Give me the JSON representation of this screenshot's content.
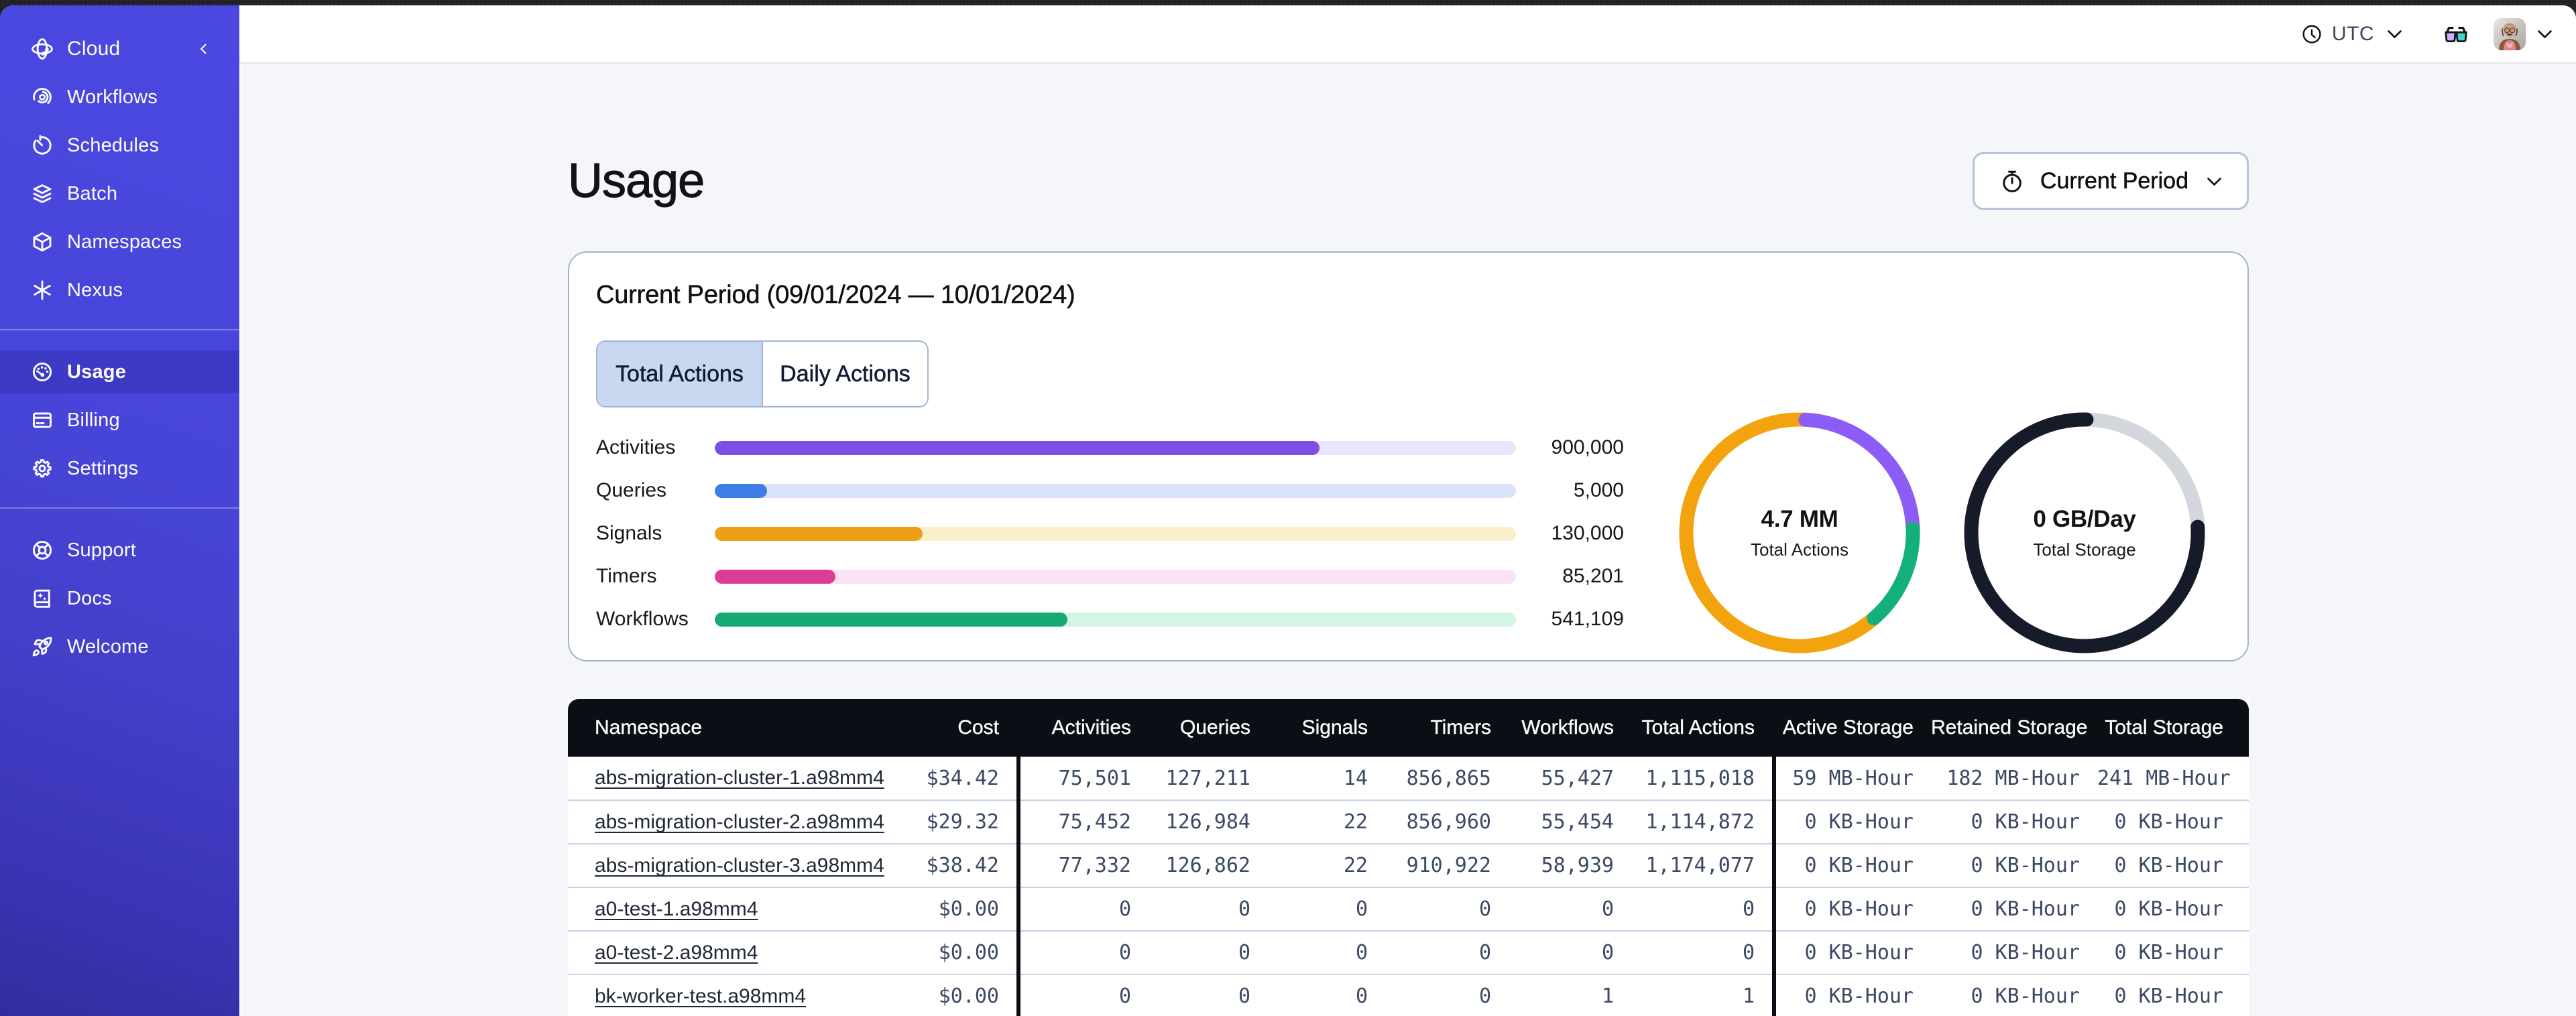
{
  "sidebar": {
    "brand": {
      "label": "Cloud",
      "icon": "temporal-cloud-logo"
    },
    "groups": [
      [
        {
          "label": "Workflows",
          "icon": "workflows-icon",
          "selected": false
        },
        {
          "label": "Schedules",
          "icon": "schedules-icon",
          "selected": false
        },
        {
          "label": "Batch",
          "icon": "batch-icon",
          "selected": false
        },
        {
          "label": "Namespaces",
          "icon": "namespaces-icon",
          "selected": false
        },
        {
          "label": "Nexus",
          "icon": "nexus-icon",
          "selected": false
        }
      ],
      [
        {
          "label": "Usage",
          "icon": "usage-icon",
          "selected": true
        },
        {
          "label": "Billing",
          "icon": "billing-icon",
          "selected": false
        },
        {
          "label": "Settings",
          "icon": "settings-icon",
          "selected": false
        }
      ],
      [
        {
          "label": "Support",
          "icon": "support-icon",
          "selected": false
        },
        {
          "label": "Docs",
          "icon": "docs-icon",
          "selected": false
        },
        {
          "label": "Welcome",
          "icon": "welcome-icon",
          "selected": false
        }
      ]
    ]
  },
  "topbar": {
    "timezone": "UTC",
    "icons": [
      "clock-icon",
      "chevron-down-icon",
      "glasses-icon",
      "avatar",
      "chevron-down-icon"
    ]
  },
  "page": {
    "title": "Usage",
    "period_button": "Current Period"
  },
  "usage_card": {
    "title": "Current Period (09/01/2024 — 10/01/2024)",
    "tabs": [
      {
        "label": "Total Actions",
        "active": true
      },
      {
        "label": "Daily Actions",
        "active": false
      }
    ]
  },
  "chart_data": [
    {
      "type": "bar",
      "orientation": "horizontal",
      "categories": [
        "Activities",
        "Queries",
        "Signals",
        "Timers",
        "Workflows"
      ],
      "values": [
        900000,
        5000,
        130000,
        85201,
        541109
      ],
      "value_labels": [
        "900,000",
        "5,000",
        "130,000",
        "85,201",
        "541,109"
      ],
      "fill_percent": [
        75.5,
        6.5,
        25.9,
        15.1,
        44.0
      ],
      "bar_colors": [
        "#7C50E2",
        "#3E7CE8",
        "#EDA016",
        "#DC3C96",
        "#16A974"
      ],
      "track_colors": [
        "#E9E4FB",
        "#D9E4F8",
        "#FAEFCB",
        "#FAE2F4",
        "#D2F5E4"
      ],
      "title": "Total Actions by type, current period"
    },
    {
      "type": "pie",
      "label": "4.7 MM",
      "sublabel": "Total Actions",
      "segments": [
        {
          "name": "base",
          "color": "#F2A30D",
          "start_deg": 139,
          "end_deg": 363
        },
        {
          "name": "purple",
          "color": "#8B5CF6",
          "start_deg": 3,
          "end_deg": 88
        },
        {
          "name": "green",
          "color": "#14B07A",
          "start_deg": 88,
          "end_deg": 139
        }
      ]
    },
    {
      "type": "pie",
      "label": "0 GB/Day",
      "sublabel": "Total Storage",
      "segments": [
        {
          "name": "base",
          "color": "#D3D6DC",
          "start_deg": 0,
          "end_deg": 360
        },
        {
          "name": "dark",
          "color": "#151B28",
          "start_deg": 87,
          "end_deg": 361
        }
      ]
    }
  ],
  "table": {
    "columns": [
      "Namespace",
      "Cost",
      "Activities",
      "Queries",
      "Signals",
      "Timers",
      "Workflows",
      "Total Actions",
      "Active Storage",
      "Retained Storage",
      "Total Storage"
    ],
    "rows": [
      [
        "abs-migration-cluster-1.a98mm4",
        "$34.42",
        "75,501",
        "127,211",
        "14",
        "856,865",
        "55,427",
        "1,115,018",
        "59 MB-Hour",
        "182 MB-Hour",
        "241 MB-Hour"
      ],
      [
        "abs-migration-cluster-2.a98mm4",
        "$29.32",
        "75,452",
        "126,984",
        "22",
        "856,960",
        "55,454",
        "1,114,872",
        "0 KB-Hour",
        "0 KB-Hour",
        "0 KB-Hour"
      ],
      [
        "abs-migration-cluster-3.a98mm4",
        "$38.42",
        "77,332",
        "126,862",
        "22",
        "910,922",
        "58,939",
        "1,174,077",
        "0 KB-Hour",
        "0 KB-Hour",
        "0 KB-Hour"
      ],
      [
        "a0-test-1.a98mm4",
        "$0.00",
        "0",
        "0",
        "0",
        "0",
        "0",
        "0",
        "0 KB-Hour",
        "0 KB-Hour",
        "0 KB-Hour"
      ],
      [
        "a0-test-2.a98mm4",
        "$0.00",
        "0",
        "0",
        "0",
        "0",
        "0",
        "0",
        "0 KB-Hour",
        "0 KB-Hour",
        "0 KB-Hour"
      ],
      [
        "bk-worker-test.a98mm4",
        "$0.00",
        "0",
        "0",
        "0",
        "0",
        "1",
        "1",
        "0 KB-Hour",
        "0 KB-Hour",
        "0 KB-Hour"
      ]
    ]
  }
}
